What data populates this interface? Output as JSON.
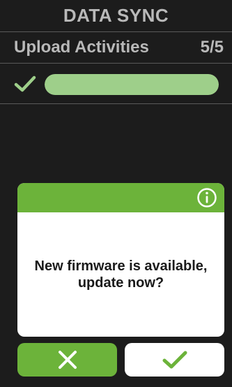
{
  "header": {
    "title": "DATA SYNC"
  },
  "subheader": {
    "label": "Upload Activities",
    "counter": "5/5"
  },
  "progress": {
    "status_icon": "check-icon",
    "fill_fraction": 1.0
  },
  "dialog": {
    "icon": "info-icon",
    "message": "New firmware is available, update now?"
  },
  "buttons": {
    "cancel_icon": "close-icon",
    "confirm_icon": "check-icon"
  },
  "colors": {
    "background": "#1c1c1c",
    "header_text": "#b9b9b9",
    "accent_green": "#6cb33a",
    "progress_green": "#9ecf8a",
    "dialog_bg": "#ffffff"
  }
}
